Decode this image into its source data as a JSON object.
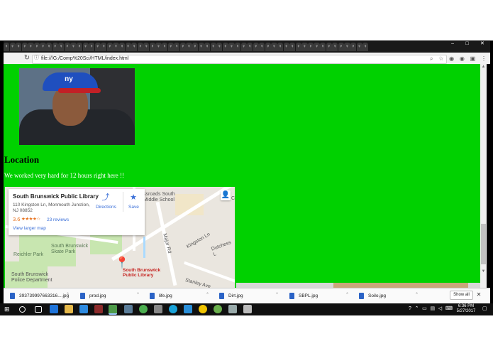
{
  "browser": {
    "tabs_count": 60,
    "tab_glyph": "♀",
    "url": "file:///G:/Comp%20Sci/HTML/index.html",
    "window_controls": [
      "–",
      "□",
      "✕"
    ]
  },
  "page": {
    "background": "#00d100",
    "heading": "Location",
    "paragraph": "We worked very hard for 12 hours right here !!",
    "photo_cap_logo": "ny"
  },
  "map": {
    "place_name": "South Brunswick Public Library",
    "address": "110 Kingston Ln, Monmouth Junction, NJ 08852",
    "rating": "3.6",
    "stars": "★★★★☆",
    "reviews": "23 reviews",
    "view_larger": "View larger map",
    "directions": "Directions",
    "save": "Save",
    "pin_label": "South Brunswick\nPublic Library",
    "labels": {
      "crossroads": "ssroads South\nMiddle School",
      "skate_park": "South Brunswick\nSkate Park",
      "reichler": "Reichler Park",
      "police": "South Brunswick\nPolice Department",
      "major_rd": "Major Rd",
      "kingston": "Kingston Ln",
      "dutchess": "Dutchess L",
      "stanley": "Stanley Ave",
      "crossroads_right": "C"
    }
  },
  "downloads": {
    "items": [
      "393739997663316....jpg",
      "prod.jpg",
      "life.jpg",
      "Dirt.jpg",
      "SBPL.jpg",
      "Soilo.jpg"
    ],
    "show_all": "Show all"
  },
  "taskbar": {
    "time": "6:36 PM",
    "date": "5/27/2017"
  }
}
